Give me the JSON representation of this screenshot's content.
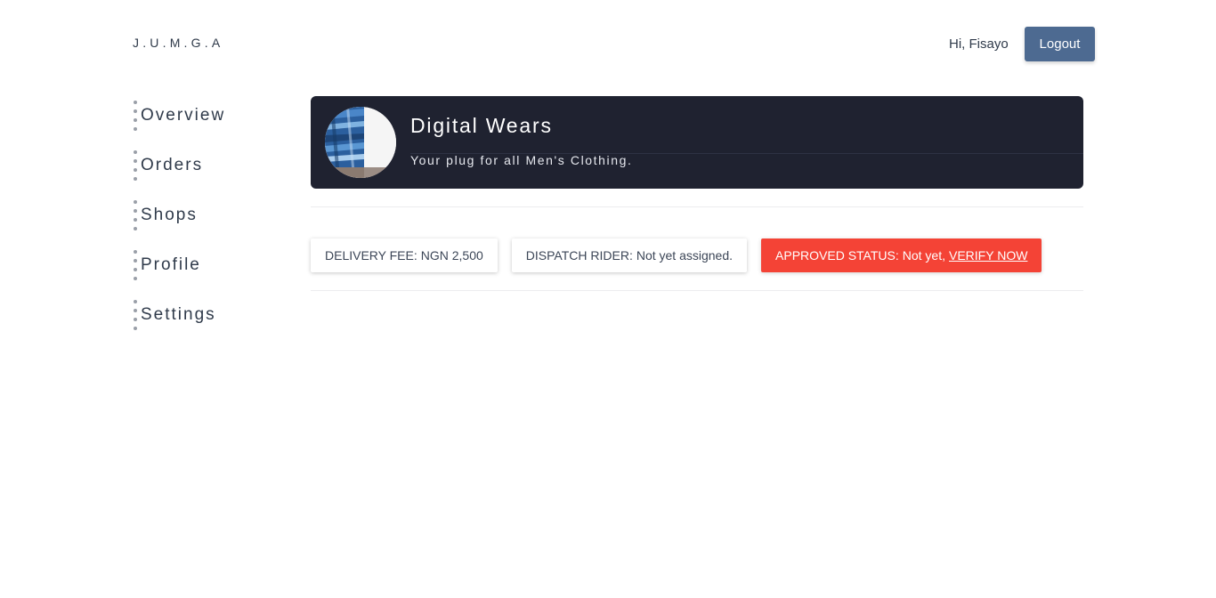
{
  "header": {
    "brand": "J.U.M.G.A",
    "greeting": "Hi, Fisayo",
    "logout_label": "Logout"
  },
  "sidebar": {
    "items": [
      {
        "label": "Overview"
      },
      {
        "label": "Orders"
      },
      {
        "label": "Shops"
      },
      {
        "label": "Profile"
      },
      {
        "label": "Settings"
      }
    ]
  },
  "shop": {
    "name": "Digital Wears",
    "tagline": "Your plug for all Men's Clothing."
  },
  "info": {
    "delivery_fee_label": "DELIVERY FEE:",
    "delivery_fee_value": "NGN 2,500",
    "dispatch_rider_label": "DISPATCH RIDER:",
    "dispatch_rider_value": "Not yet assigned.",
    "approved_status_label": "APPROVED STATUS:",
    "approved_status_value": "Not yet,",
    "verify_link": "VERIFY NOW"
  },
  "colors": {
    "primary_button": "#4d6a91",
    "banner_bg": "#1f2230",
    "alert": "#f44336"
  }
}
